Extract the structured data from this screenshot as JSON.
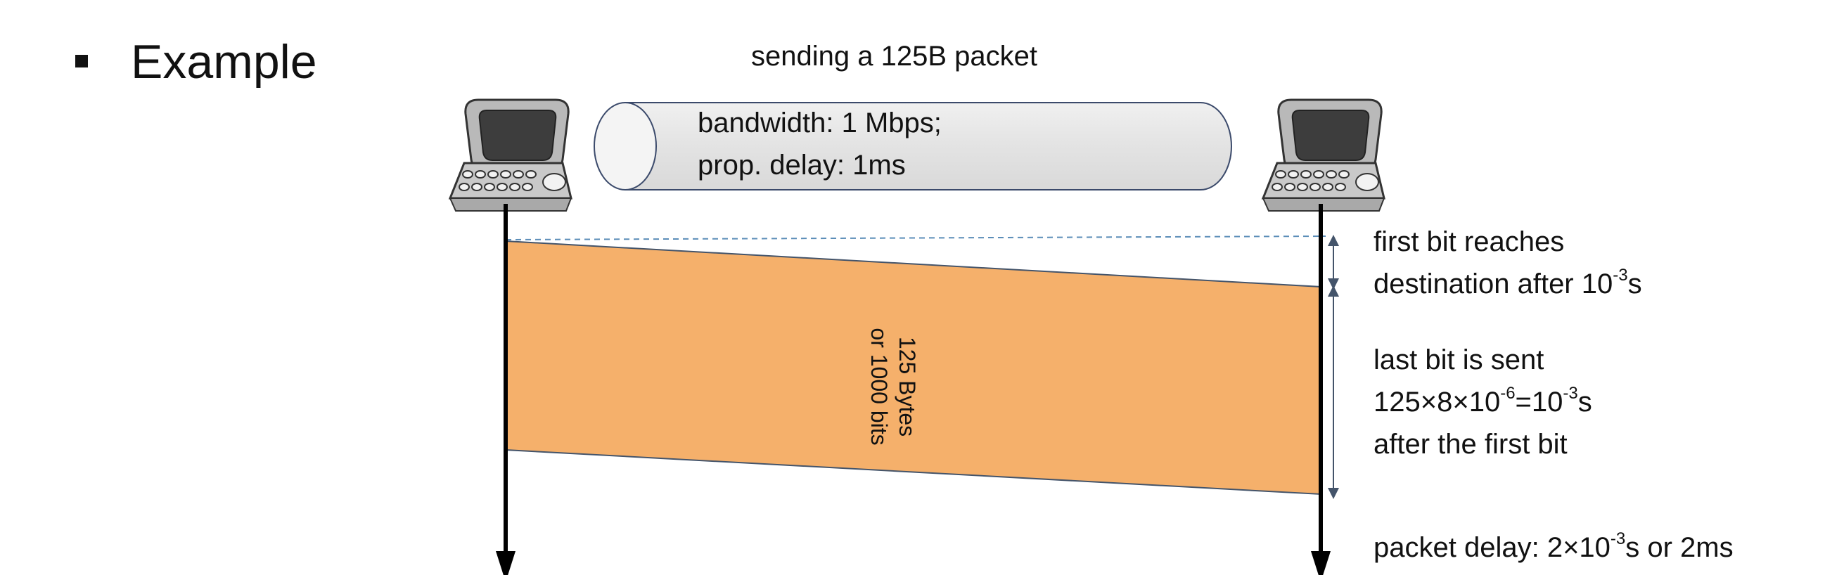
{
  "slide": {
    "heading": "Example",
    "bullet": "▪"
  },
  "link": {
    "caption": "sending a 125B packet",
    "bandwidth": "bandwidth: 1 Mbps;",
    "prop_delay": "prop. delay: 1ms"
  },
  "packet": {
    "line1": "125 Bytes",
    "line2": "or 1000 bits",
    "color": "#F5B06B"
  },
  "notes": {
    "first_bit": {
      "line1": "first bit reaches",
      "line2_prefix": "destination after 10",
      "line2_sup": "-3",
      "line2_suffix": "s"
    },
    "last_bit": {
      "line1": "last bit is sent",
      "line2_a": "125×8×10",
      "line2_sup1": "-6",
      "line2_b": "=10",
      "line2_sup2": "-3",
      "line2_c": "s",
      "line3": "after the first bit"
    },
    "packet_delay": {
      "prefix": "packet delay: 2×10",
      "sup": "-3",
      "suffix": "s or 2ms"
    }
  },
  "icons": {
    "sender": "computer-icon",
    "receiver": "computer-icon",
    "link": "cylinder-cable-icon"
  }
}
